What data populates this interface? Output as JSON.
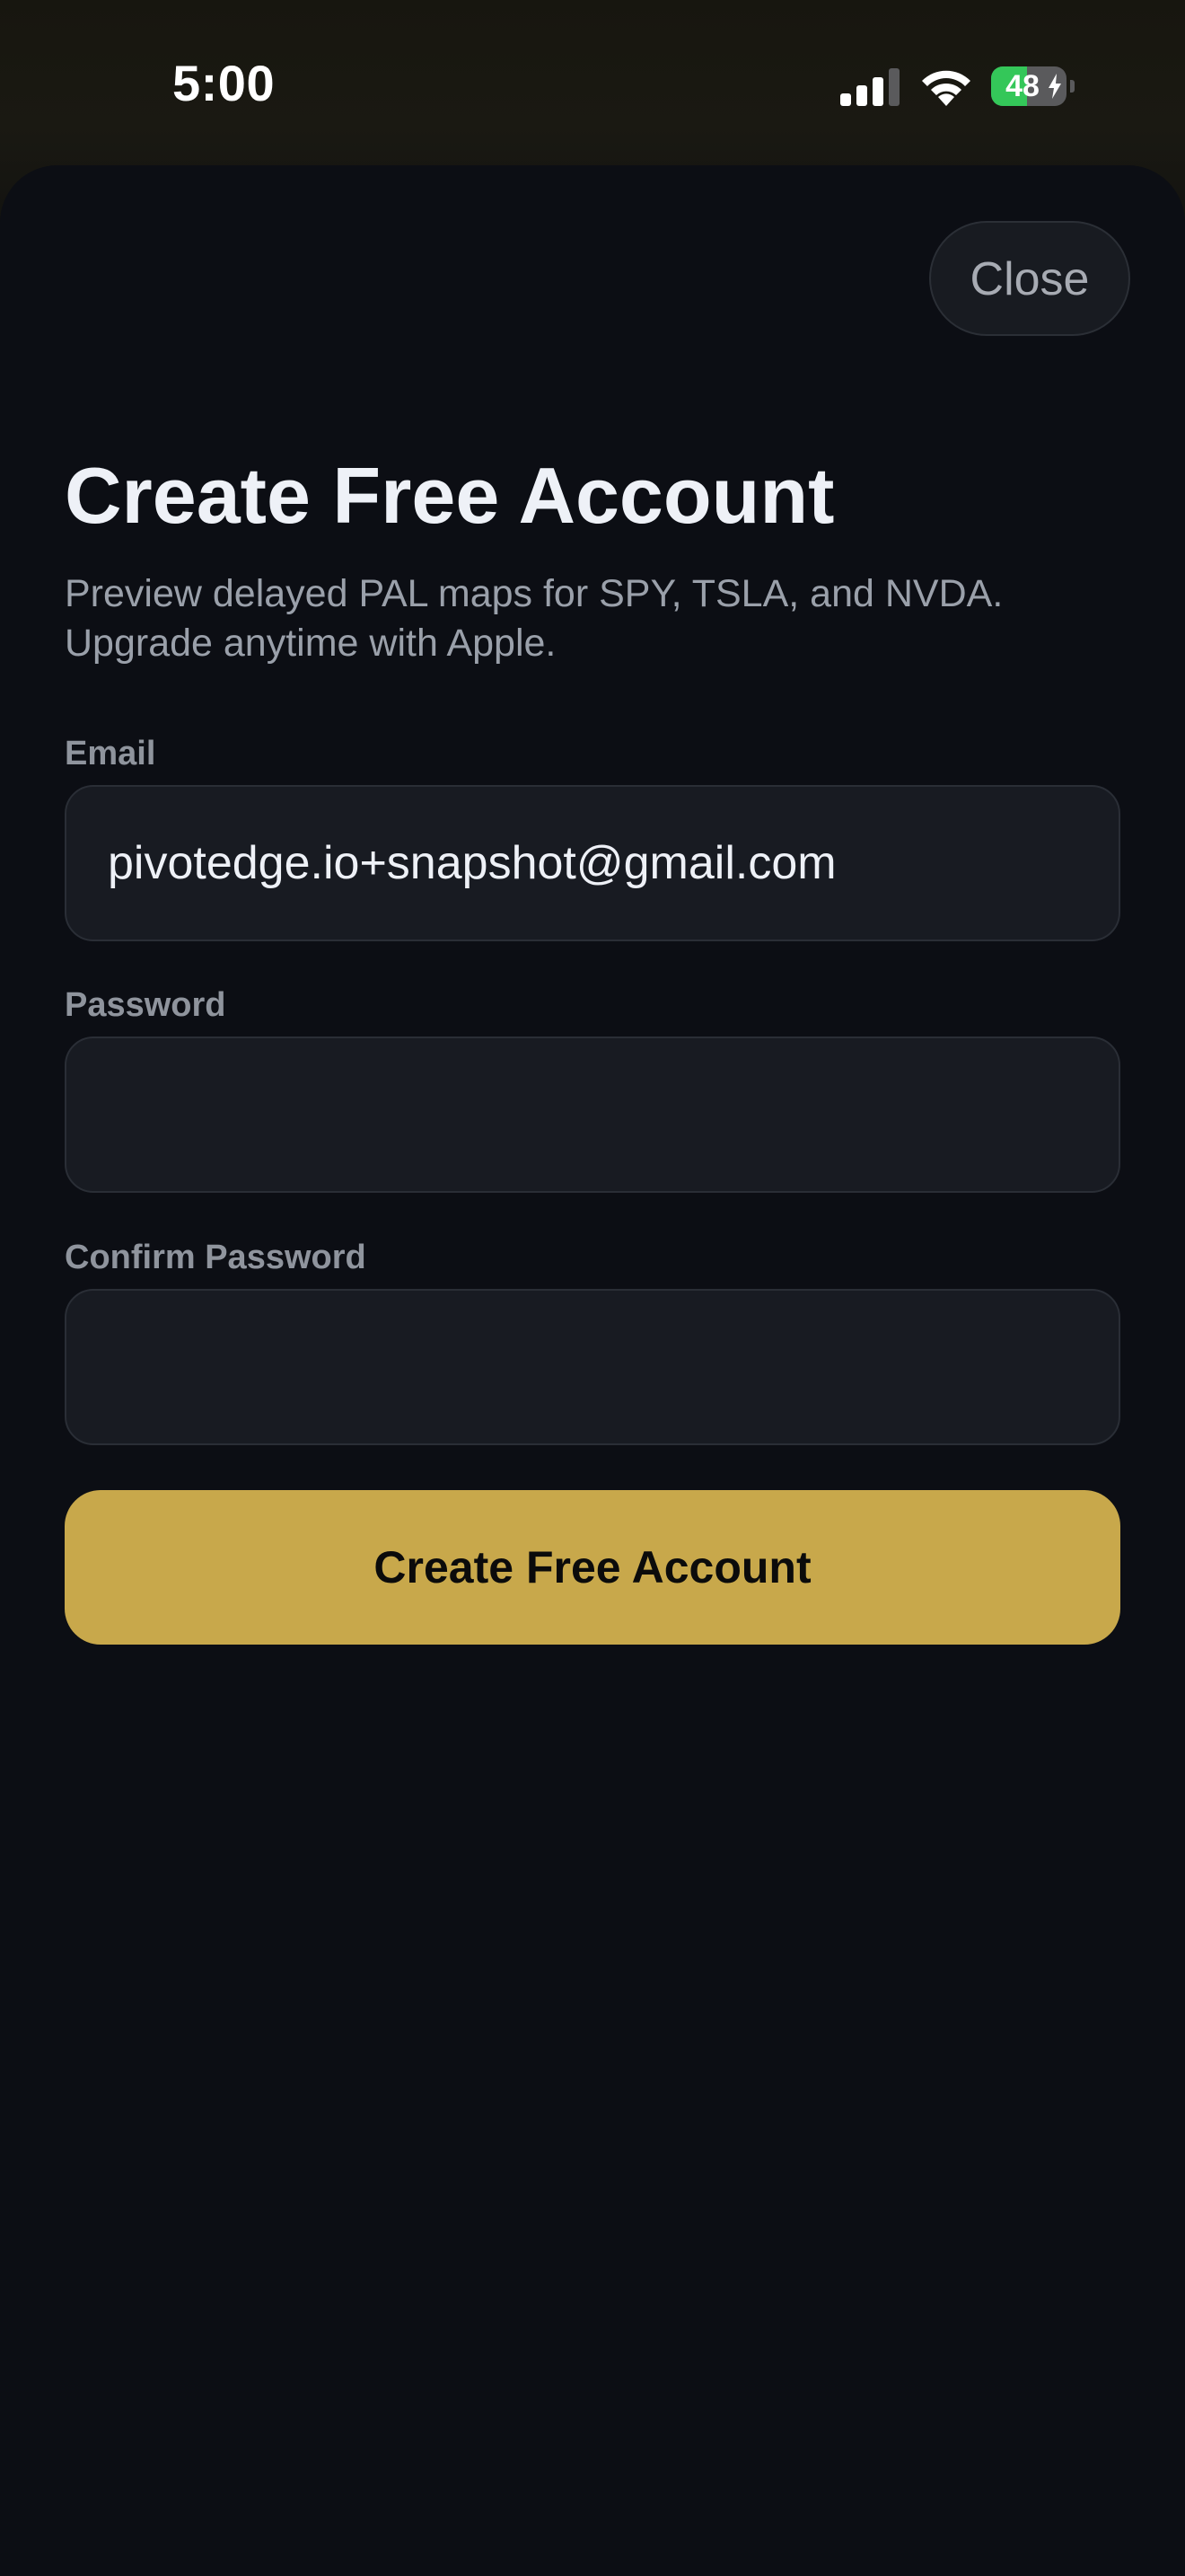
{
  "status_bar": {
    "time": "5:00",
    "battery_level": "48",
    "battery_fraction": 0.48,
    "icons": [
      "cellular-signal-icon",
      "wifi-icon",
      "battery-charging-icon"
    ]
  },
  "sheet": {
    "close_label": "Close",
    "title": "Create Free Account",
    "subtitle": "Preview delayed PAL maps for SPY, TSLA, and NVDA. Upgrade anytime with Apple."
  },
  "form": {
    "email": {
      "label": "Email",
      "value": "pivotedge.io+snapshot@gmail.com"
    },
    "password": {
      "label": "Password",
      "value": ""
    },
    "confirm_password": {
      "label": "Confirm Password",
      "value": ""
    },
    "submit_label": "Create Free Account"
  },
  "colors": {
    "accent": "#c8a84b",
    "background": "#0c0e14",
    "field_background": "#181b22",
    "battery_green": "#34c759"
  }
}
